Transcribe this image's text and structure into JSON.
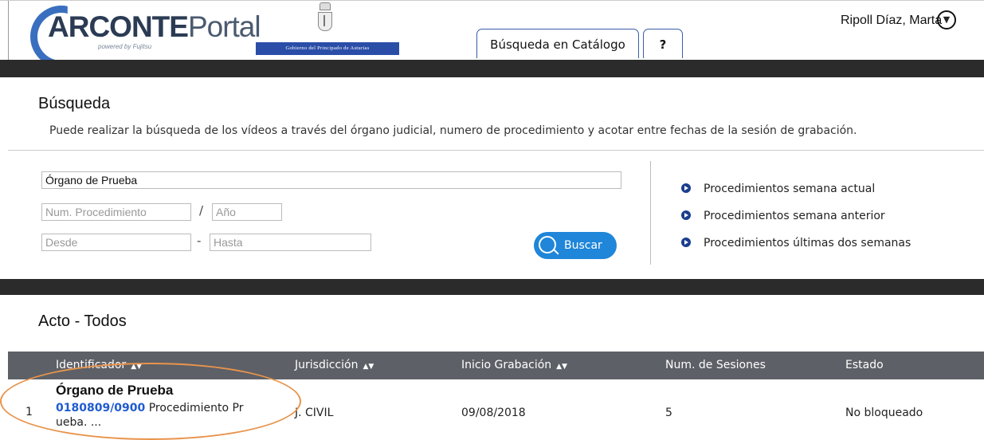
{
  "header": {
    "logo": {
      "arc": "ARCONTE",
      "portal": "Portal",
      "tagline": "powered by Fujitsu"
    },
    "government": "Gobierno del Principado de Asturias",
    "tabs": [
      {
        "label": "Búsqueda en Catálogo"
      },
      {
        "label": "?"
      }
    ],
    "user": {
      "name": "Ripoll Díaz, Marta",
      "menu_icon": "chevron-down-circle-icon"
    }
  },
  "search": {
    "title": "Búsqueda",
    "description": "Puede realizar la búsqueda de los vídeos a través del órgano judicial, numero de procedimiento y acotar entre fechas de la sesión de grabación.",
    "organo_value": "Órgano de Prueba",
    "num_procedimiento_placeholder": "Num. Procedimiento",
    "slash": "/",
    "anio_placeholder": "Año",
    "desde_placeholder": "Desde",
    "dash": "-",
    "hasta_placeholder": "Hasta",
    "button_label": "Buscar",
    "quick_links": [
      {
        "label": "Procedimientos semana actual"
      },
      {
        "label": "Procedimientos semana anterior"
      },
      {
        "label": "Procedimientos últimas dos semanas"
      }
    ]
  },
  "results": {
    "title": "Acto - Todos",
    "sort_arrows": "▲▼",
    "columns": [
      {
        "label": "Identificador"
      },
      {
        "label": "Jurisdicción"
      },
      {
        "label": "Inicio Grabación"
      },
      {
        "label": "Num. de Sesiones"
      },
      {
        "label": "Estado"
      }
    ],
    "rows": [
      {
        "index": "1",
        "title": "Órgano de Prueba",
        "code": "0180809/0900",
        "desc_line1": "Procedimiento Pr",
        "desc_line2": "ueba. ...",
        "jurisdiccion": "J. CIVIL",
        "inicio": "09/08/2018",
        "sesiones": "5",
        "estado": "No bloqueado"
      }
    ]
  },
  "colors": {
    "accent": "#1f86d9",
    "brand": "#2a4ea8",
    "table_header": "#5d6066",
    "highlight": "#e8944c",
    "link": "#1f5bd0"
  }
}
